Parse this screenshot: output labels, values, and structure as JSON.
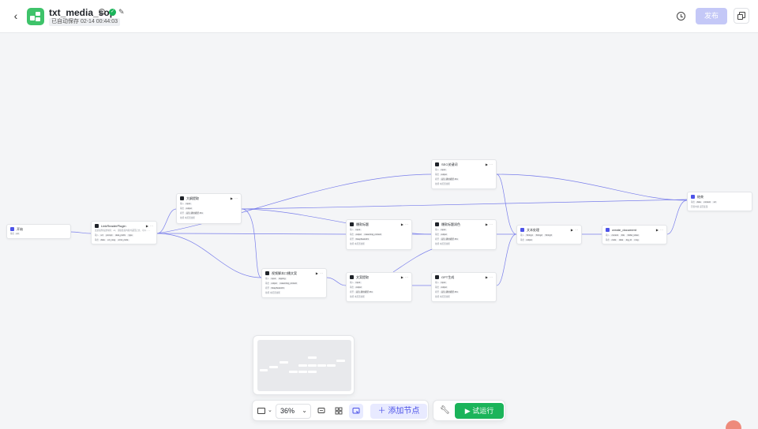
{
  "header": {
    "app_name": "txt_media_sop",
    "autosave_label": "已自动保存 02-14 00:44:03",
    "publish_label": "发布"
  },
  "nodes": {
    "start": {
      "title": "开始",
      "r1": "输出",
      "r1c": "url"
    },
    "reader": {
      "title": "LinkReaderPlugin",
      "r1": "这是插件描述内容：url，读取链接内容并返回正文，可以……",
      "r2": "输入",
      "r2c": [
        "url",
        "prompt",
        "data_prefix",
        "type"
      ],
      "r3": "输出",
      "r3c": [
        "data",
        "err_msg",
        "error_code"
      ]
    },
    "outline": {
      "title": "大纲提取",
      "r1": "输入",
      "r1c": "input",
      "r2": "输出",
      "r2c": "output",
      "r3": "模型",
      "r3c": "豆包·通用模型·Pro",
      "r4": "技能",
      "r4c": "未配置技能"
    },
    "title_node": {
      "title": "爆款标题",
      "r1": "输入",
      "r1c": "input",
      "r2": "输出",
      "r2c": [
        "output",
        "reasoning_content"
      ],
      "r3": "模型",
      "r3c": "DeepSeek-R1",
      "r4": "技能",
      "r4c": "未配置技能"
    },
    "review": {
      "title": "视频脚本口播文案",
      "r1": "输入",
      "r1c": [
        "input",
        "topping"
      ],
      "r2": "输出",
      "r2c": [
        "output",
        "reasoning_content"
      ],
      "r3": "模型",
      "r3c": "DeepSeek-R1",
      "r4": "技能",
      "r4c": "未配置技能"
    },
    "seo": {
      "title": "SEO关键词",
      "r1": "输入",
      "r1c": "input",
      "r2": "输出",
      "r2c": "output",
      "r3": "模型",
      "r3c": "豆包·通用模型·Pro",
      "r4": "技能",
      "r4c": "未配置技能"
    },
    "title_opt": {
      "title": "爆款标题润色",
      "r1": "输入",
      "r1c": "input",
      "r2": "输出",
      "r2c": "output",
      "r3": "模型",
      "r3c": "豆包·通用模型·Pro",
      "r4": "技能",
      "r4c": "未配置技能"
    },
    "copy_node": {
      "title": "文案提取",
      "r1": "输入",
      "r1c": "input",
      "r2": "输出",
      "r2c": "output",
      "r3": "模型",
      "r3c": "豆包·通用模型·Pro",
      "r4": "技能",
      "r4c": "未配置技能"
    },
    "gpt": {
      "title": "GPT生成",
      "r1": "输入",
      "r1c": "input",
      "r2": "输出",
      "r2c": "output",
      "r3": "模型",
      "r3c": "豆包·通用模型·Pro",
      "r4": "技能",
      "r4c": "未配置技能"
    },
    "merge": {
      "title": "文本处理",
      "r1": "输入",
      "r1c": [
        "String1",
        "String2",
        "String3"
      ],
      "r2": "输出",
      "r2c": "output"
    },
    "doc": {
      "title": "create_document",
      "r1": "输入",
      "r1c": [
        "content",
        "title",
        "folder_token"
      ],
      "r2": "输出",
      "r2c": [
        "code",
        "data",
        "log_id",
        "msg"
      ]
    },
    "end": {
      "title": "结束",
      "r1": "输出",
      "r1c": [
        "data",
        "content",
        "url"
      ],
      "r2": "回答内容",
      "r2c": "返回变量"
    }
  },
  "toolbar": {
    "zoom": "36%",
    "add_node_label": "添加节点",
    "run_label": "试运行"
  }
}
